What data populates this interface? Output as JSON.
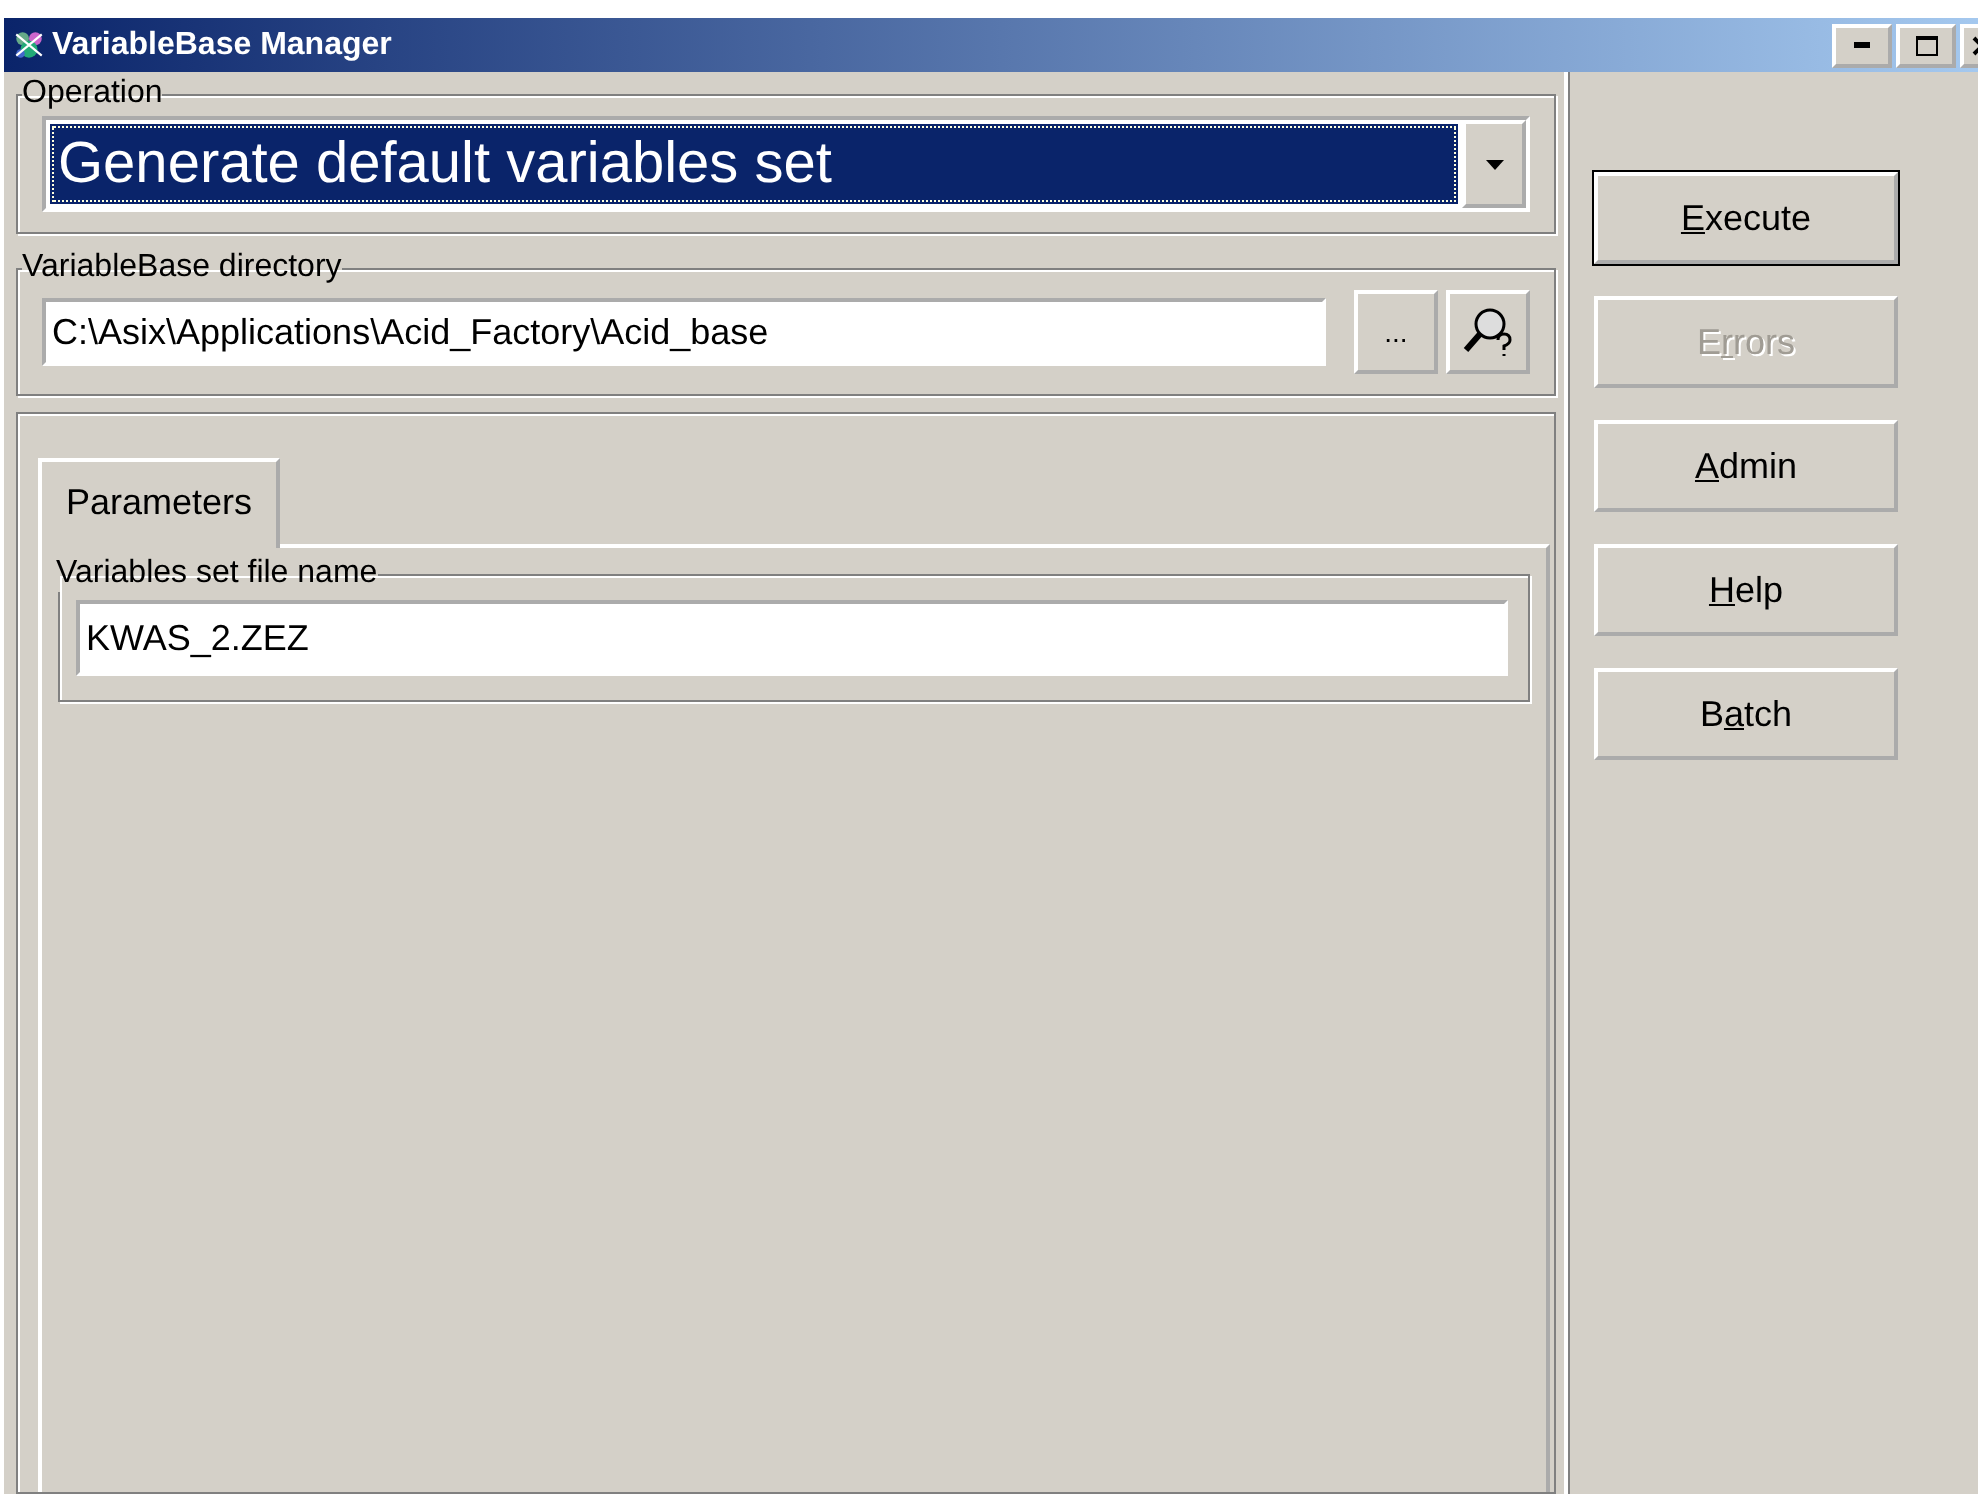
{
  "window": {
    "title": "VariableBase Manager"
  },
  "operation": {
    "legend": "Operation",
    "value": "Generate default variables set",
    "focused": true
  },
  "directory": {
    "legend": "VariableBase directory",
    "value": "C:\\Asix\\Applications\\Acid_Factory\\Acid_base",
    "browse_label": "..."
  },
  "tabs": [
    {
      "label": "Parameters",
      "selected": true
    }
  ],
  "parameters": {
    "legend": "Variables set file name",
    "value": "KWAS_2.ZEZ"
  },
  "buttons": [
    {
      "access_key": "E",
      "text_after": "xecute",
      "default": true,
      "disabled": false
    },
    {
      "text_before": "E",
      "access_key": "r",
      "text_after": "rors",
      "default": false,
      "disabled": true
    },
    {
      "access_key": "A",
      "text_after": "dmin",
      "default": false,
      "disabled": false
    },
    {
      "access_key": "H",
      "text_after": "elp",
      "default": false,
      "disabled": false
    },
    {
      "text_before": "B",
      "access_key": "a",
      "text_after": "tch",
      "default": false,
      "disabled": false
    }
  ]
}
